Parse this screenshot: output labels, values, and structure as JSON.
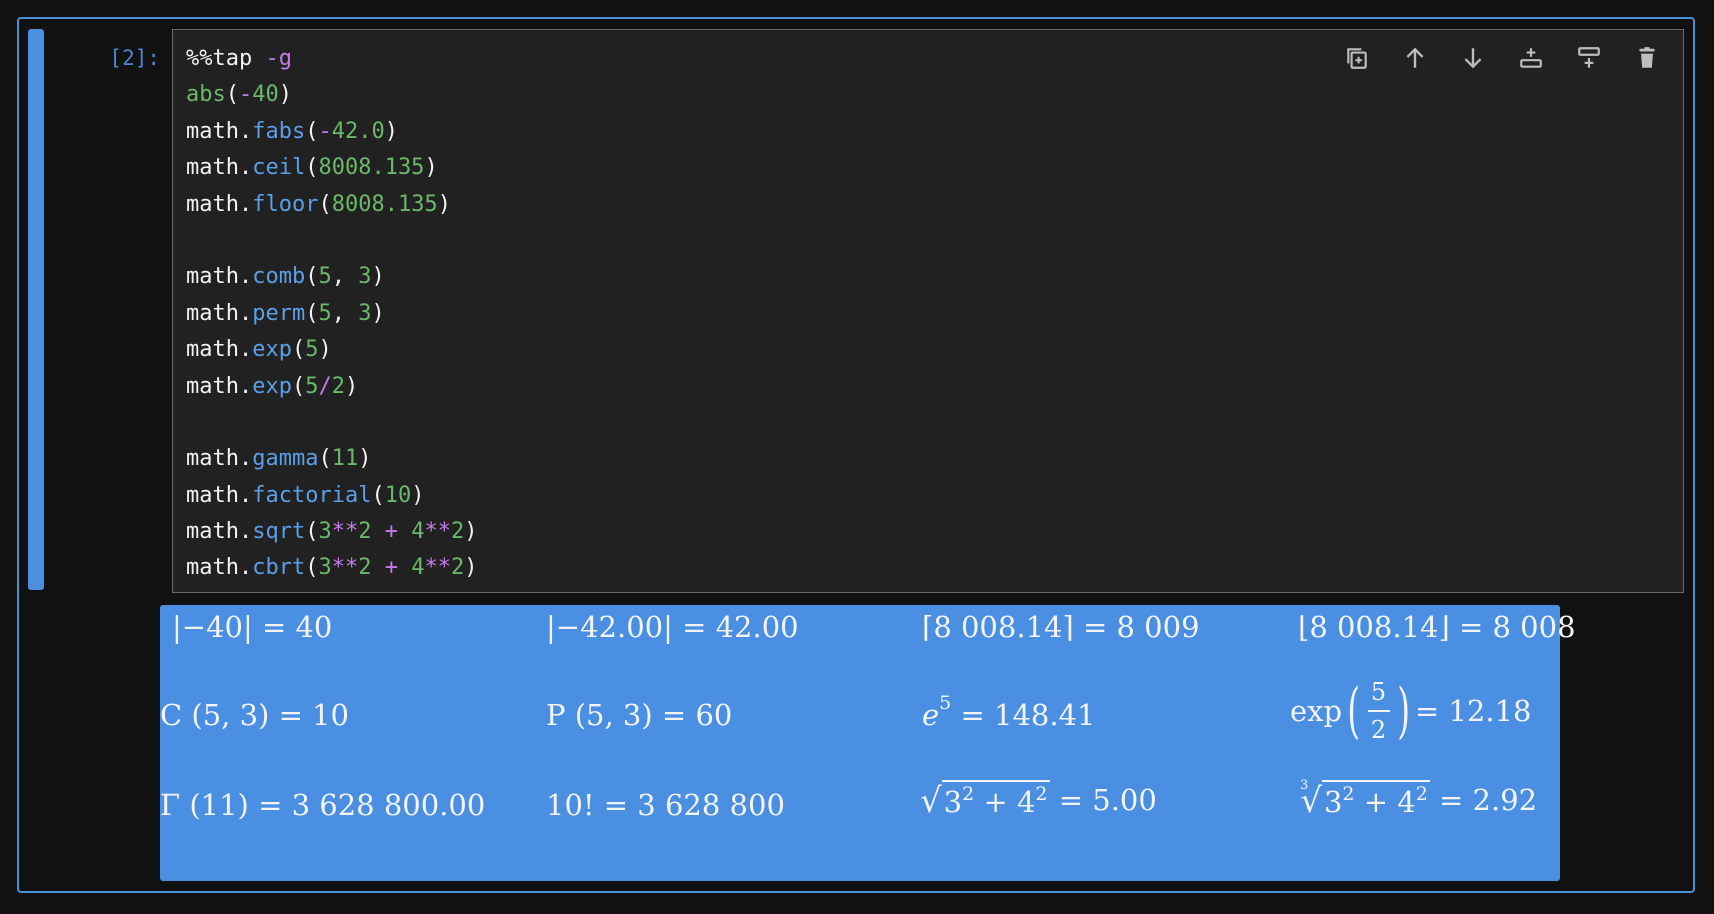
{
  "cell": {
    "prompt": "[2]:",
    "code_lines": [
      [
        {
          "t": "%%tap ",
          "c": "name"
        },
        {
          "t": "-g",
          "c": "op"
        }
      ],
      [
        {
          "t": "abs",
          "c": "green"
        },
        {
          "t": "(",
          "c": "name"
        },
        {
          "t": "-",
          "c": "op"
        },
        {
          "t": "40",
          "c": "num"
        },
        {
          "t": ")",
          "c": "name"
        }
      ],
      [
        {
          "t": "math.",
          "c": "name"
        },
        {
          "t": "fabs",
          "c": "fn"
        },
        {
          "t": "(",
          "c": "name"
        },
        {
          "t": "-",
          "c": "op"
        },
        {
          "t": "42.0",
          "c": "num"
        },
        {
          "t": ")",
          "c": "name"
        }
      ],
      [
        {
          "t": "math.",
          "c": "name"
        },
        {
          "t": "ceil",
          "c": "fn"
        },
        {
          "t": "(",
          "c": "name"
        },
        {
          "t": "8008.135",
          "c": "num"
        },
        {
          "t": ")",
          "c": "name"
        }
      ],
      [
        {
          "t": "math.",
          "c": "name"
        },
        {
          "t": "floor",
          "c": "fn"
        },
        {
          "t": "(",
          "c": "name"
        },
        {
          "t": "8008.135",
          "c": "num"
        },
        {
          "t": ")",
          "c": "name"
        }
      ],
      [],
      [
        {
          "t": "math.",
          "c": "name"
        },
        {
          "t": "comb",
          "c": "fn"
        },
        {
          "t": "(",
          "c": "name"
        },
        {
          "t": "5",
          "c": "num"
        },
        {
          "t": ", ",
          "c": "name"
        },
        {
          "t": "3",
          "c": "num"
        },
        {
          "t": ")",
          "c": "name"
        }
      ],
      [
        {
          "t": "math.",
          "c": "name"
        },
        {
          "t": "perm",
          "c": "fn"
        },
        {
          "t": "(",
          "c": "name"
        },
        {
          "t": "5",
          "c": "num"
        },
        {
          "t": ", ",
          "c": "name"
        },
        {
          "t": "3",
          "c": "num"
        },
        {
          "t": ")",
          "c": "name"
        }
      ],
      [
        {
          "t": "math.",
          "c": "name"
        },
        {
          "t": "exp",
          "c": "fn"
        },
        {
          "t": "(",
          "c": "name"
        },
        {
          "t": "5",
          "c": "num"
        },
        {
          "t": ")",
          "c": "name"
        }
      ],
      [
        {
          "t": "math.",
          "c": "name"
        },
        {
          "t": "exp",
          "c": "fn"
        },
        {
          "t": "(",
          "c": "name"
        },
        {
          "t": "5",
          "c": "num"
        },
        {
          "t": "/",
          "c": "op"
        },
        {
          "t": "2",
          "c": "num"
        },
        {
          "t": ")",
          "c": "name"
        }
      ],
      [],
      [
        {
          "t": "math.",
          "c": "name"
        },
        {
          "t": "gamma",
          "c": "fn"
        },
        {
          "t": "(",
          "c": "name"
        },
        {
          "t": "11",
          "c": "num"
        },
        {
          "t": ")",
          "c": "name"
        }
      ],
      [
        {
          "t": "math.",
          "c": "name"
        },
        {
          "t": "factorial",
          "c": "fn"
        },
        {
          "t": "(",
          "c": "name"
        },
        {
          "t": "10",
          "c": "num"
        },
        {
          "t": ")",
          "c": "name"
        }
      ],
      [
        {
          "t": "math.",
          "c": "name"
        },
        {
          "t": "sqrt",
          "c": "fn"
        },
        {
          "t": "(",
          "c": "name"
        },
        {
          "t": "3",
          "c": "num"
        },
        {
          "t": "**",
          "c": "op"
        },
        {
          "t": "2",
          "c": "num"
        },
        {
          "t": " + ",
          "c": "op"
        },
        {
          "t": "4",
          "c": "num"
        },
        {
          "t": "**",
          "c": "op"
        },
        {
          "t": "2",
          "c": "num"
        },
        {
          "t": ")",
          "c": "name"
        }
      ],
      [
        {
          "t": "math.",
          "c": "name"
        },
        {
          "t": "cbrt",
          "c": "fn"
        },
        {
          "t": "(",
          "c": "name"
        },
        {
          "t": "3",
          "c": "num"
        },
        {
          "t": "**",
          "c": "op"
        },
        {
          "t": "2",
          "c": "num"
        },
        {
          "t": " + ",
          "c": "op"
        },
        {
          "t": "4",
          "c": "num"
        },
        {
          "t": "**",
          "c": "op"
        },
        {
          "t": "2",
          "c": "num"
        },
        {
          "t": ")",
          "c": "name"
        }
      ]
    ]
  },
  "toolbar": {
    "icons": [
      "duplicate-icon",
      "move-up-icon",
      "move-down-icon",
      "insert-above-icon",
      "insert-below-icon",
      "delete-icon"
    ]
  },
  "outputs": {
    "abs": {
      "lhs": "|−40|",
      "rhs": "= 40"
    },
    "fabs": {
      "lhs": "|−42.00|",
      "rhs": "= 42.00"
    },
    "ceil": {
      "lhs": "⌈8 008.14⌉",
      "rhs": "= 8 009"
    },
    "floor": {
      "lhs": "⌊8 008.14⌋",
      "rhs": "= 8 008"
    },
    "comb": {
      "lhs": "C (5, 3)",
      "rhs": "= 10"
    },
    "perm": {
      "lhs": "P (5, 3)",
      "rhs": "= 60"
    },
    "exp5": {
      "base": "e",
      "power": "5",
      "rhs": "= 148.41"
    },
    "exp52": {
      "fn": "exp",
      "num": "5",
      "den": "2",
      "rhs": "= 12.18"
    },
    "gamma": {
      "lhs": "Γ (11)",
      "rhs": "= 3 628 800.00"
    },
    "factorial": {
      "lhs": "10!",
      "rhs": "= 3 628 800"
    },
    "sqrt": {
      "radicand_a": "3",
      "radicand_b": "4",
      "exp": "2",
      "plus": "+",
      "rhs": "= 5.00"
    },
    "cbrt": {
      "index": "3",
      "radicand_a": "3",
      "radicand_b": "4",
      "exp": "2",
      "plus": "+",
      "rhs": "= 2.92"
    }
  },
  "colors": {
    "accent": "#4b8fe2",
    "function": "#5a9fe8",
    "number": "#6ab86a",
    "operator": "#c57bea"
  }
}
